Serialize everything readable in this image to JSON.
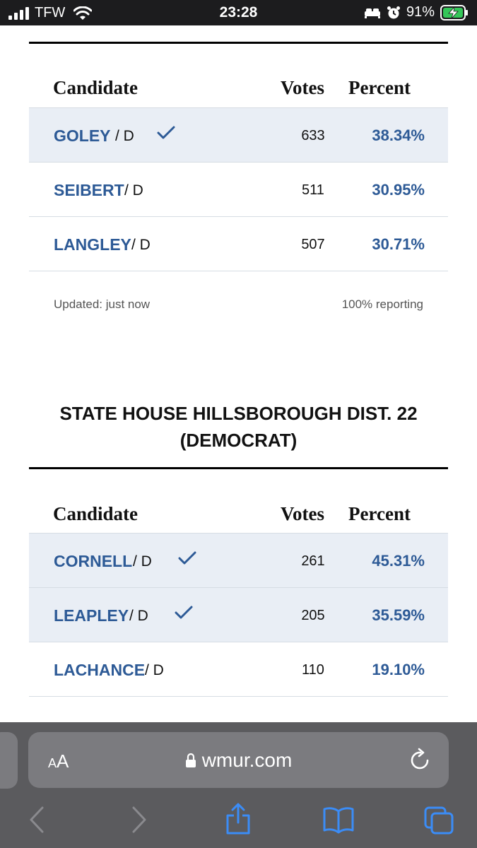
{
  "status_bar": {
    "carrier": "TFW",
    "time": "23:28",
    "battery": "91%"
  },
  "table_header": {
    "candidate": "Candidate",
    "votes": "Votes",
    "percent": "Percent"
  },
  "race1": {
    "rows": [
      {
        "name": "GOLEY",
        "party": " / D",
        "votes": "633",
        "percent": "38.34%",
        "winner": true
      },
      {
        "name": "SEIBERT",
        "party": " / D",
        "votes": "511",
        "percent": "30.95%",
        "winner": false
      },
      {
        "name": "LANGLEY",
        "party": " / D",
        "votes": "507",
        "percent": "30.71%",
        "winner": false
      }
    ],
    "updated": "Updated: just now",
    "reporting": "100% reporting"
  },
  "race2": {
    "title_line1": "STATE HOUSE HILLSBOROUGH DIST. 22",
    "title_line2": "(DEMOCRAT)",
    "rows": [
      {
        "name": "CORNELL",
        "party": " / D",
        "votes": "261",
        "percent": "45.31%",
        "winner": true
      },
      {
        "name": "LEAPLEY",
        "party": " / D",
        "votes": "205",
        "percent": "35.59%",
        "winner": true
      },
      {
        "name": "LACHANCE",
        "party": " / D",
        "votes": "110",
        "percent": "19.10%",
        "winner": false
      }
    ]
  },
  "browser": {
    "aa_small": "A",
    "aa_large": "A",
    "url": "wmur.com"
  },
  "colors": {
    "link_blue": "#2d5a96",
    "winner_row_bg": "#e9eef5",
    "toolbar_blue": "#3b8cf6"
  }
}
